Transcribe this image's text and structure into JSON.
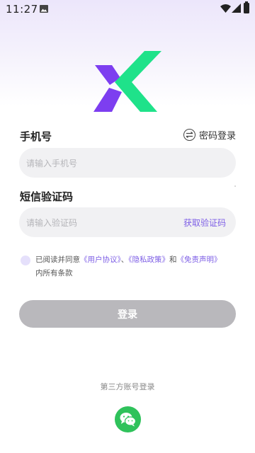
{
  "status_bar": {
    "time": "11:27",
    "image_icon": "image-icon",
    "wifi_icon": "wifi-icon",
    "signal_icon": "signal-icon",
    "battery_icon": "battery-icon"
  },
  "logo": {
    "icon": "x-logo-icon",
    "colors": {
      "green": "#1fe28a",
      "purple": "#7d3ef0"
    }
  },
  "phone": {
    "label": "手机号",
    "placeholder": "请输入手机号"
  },
  "password_login": {
    "label": "密码登录",
    "icon": "swap-arrows-icon"
  },
  "code": {
    "label": "短信验证码",
    "placeholder": "请输入验证码",
    "get_code": "获取验证码"
  },
  "agreement": {
    "prefix": "已阅读并同意",
    "user_agreement": "《用户协议》",
    "sep1": "、",
    "privacy_policy": "《隐私政策》",
    "and": "和",
    "disclaimer": "《免责声明》",
    "suffix": "内所有条款"
  },
  "login_button": "登录",
  "third_party": {
    "label": "第三方账号登录",
    "wechat_icon": "wechat-icon"
  },
  "colors": {
    "accent": "#7e5fe6",
    "button_disabled": "#b9b8bc",
    "wechat": "#2fc25b"
  }
}
